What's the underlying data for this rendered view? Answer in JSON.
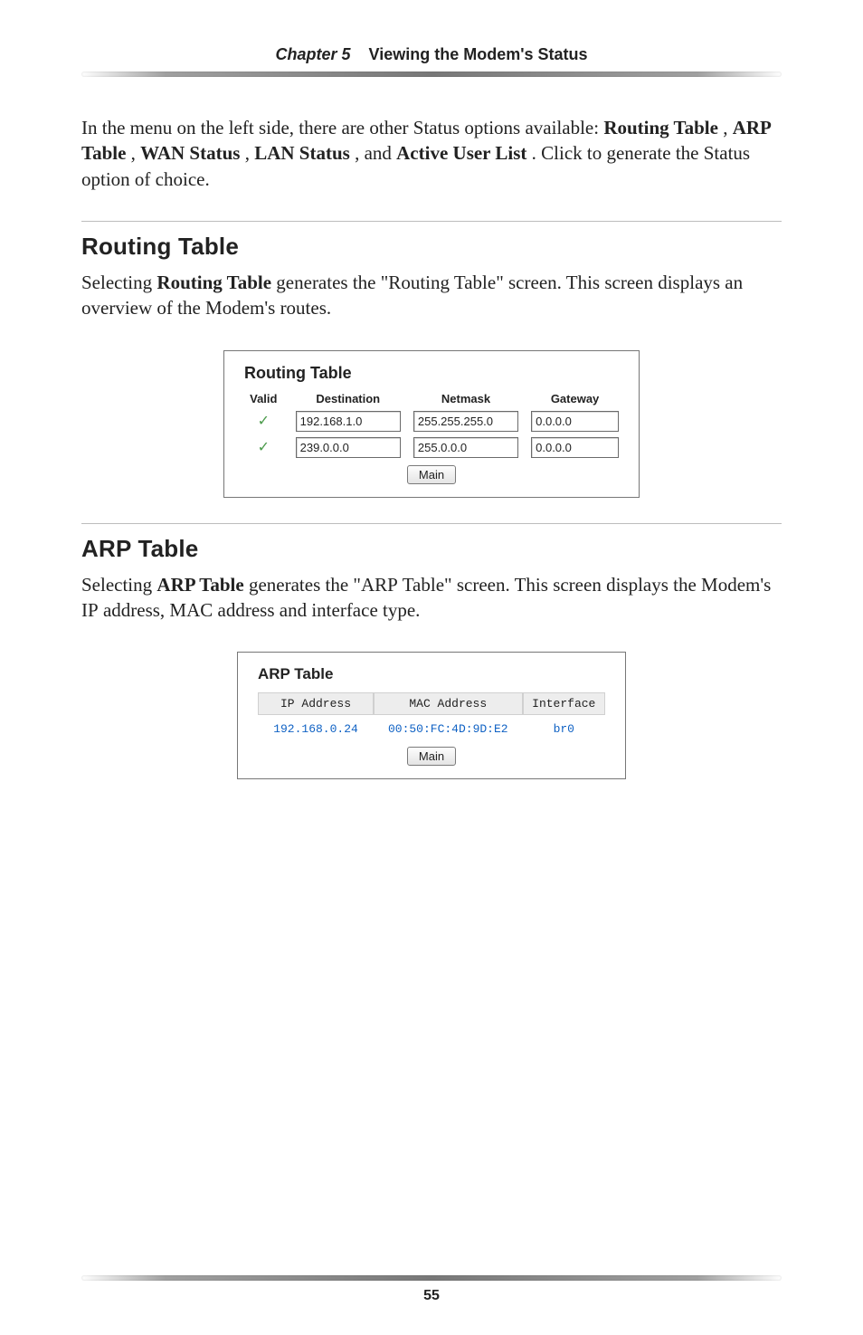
{
  "chapter": {
    "label": "Chapter 5",
    "title": "Viewing the Modem's Status"
  },
  "intro": {
    "pre": "In the menu on the left side, there are other Status options available: ",
    "opt1": "Routing Table",
    "sep1": ", ",
    "opt2": "ARP Table",
    "sep2": ", ",
    "opt3": "WAN Status",
    "sep3": ", ",
    "opt4": "LAN Status",
    "sep4": ", and ",
    "opt5": "Active User List",
    "post": ". Click to generate the Status option of choice."
  },
  "routing": {
    "heading": "Routing Table",
    "desc_pre": "Selecting ",
    "desc_bold": "Routing Table",
    "desc_post": " generates the \"Routing Table\" screen. This screen displays an overview of the Modem's routes.",
    "fig_title": "Routing Table",
    "columns": {
      "valid": "Valid",
      "dest": "Destination",
      "mask": "Netmask",
      "gw": "Gateway"
    },
    "rows": [
      {
        "valid": "✓",
        "dest": "192.168.1.0",
        "mask": "255.255.255.0",
        "gw": "0.0.0.0"
      },
      {
        "valid": "✓",
        "dest": "239.0.0.0",
        "mask": "255.0.0.0",
        "gw": "0.0.0.0"
      }
    ],
    "button": "Main"
  },
  "arp": {
    "heading": "ARP Table",
    "desc_pre": "Selecting ",
    "desc_bold": "ARP Table",
    "desc_mid1": " generates the \"",
    "desc_sc1": "ARP",
    "desc_mid2": " Table\" screen. This screen displays the Modem's ",
    "desc_sc2": "IP",
    "desc_mid3": " address, ",
    "desc_sc3": "MAC",
    "desc_post": " address and interface type.",
    "fig_title": "ARP Table",
    "columns": {
      "ip": "IP Address",
      "mac": "MAC Address",
      "iface": "Interface"
    },
    "rows": [
      {
        "ip": "192.168.0.24",
        "mac": "00:50:FC:4D:9D:E2",
        "iface": "br0"
      }
    ],
    "button": "Main"
  },
  "page_number": "55"
}
